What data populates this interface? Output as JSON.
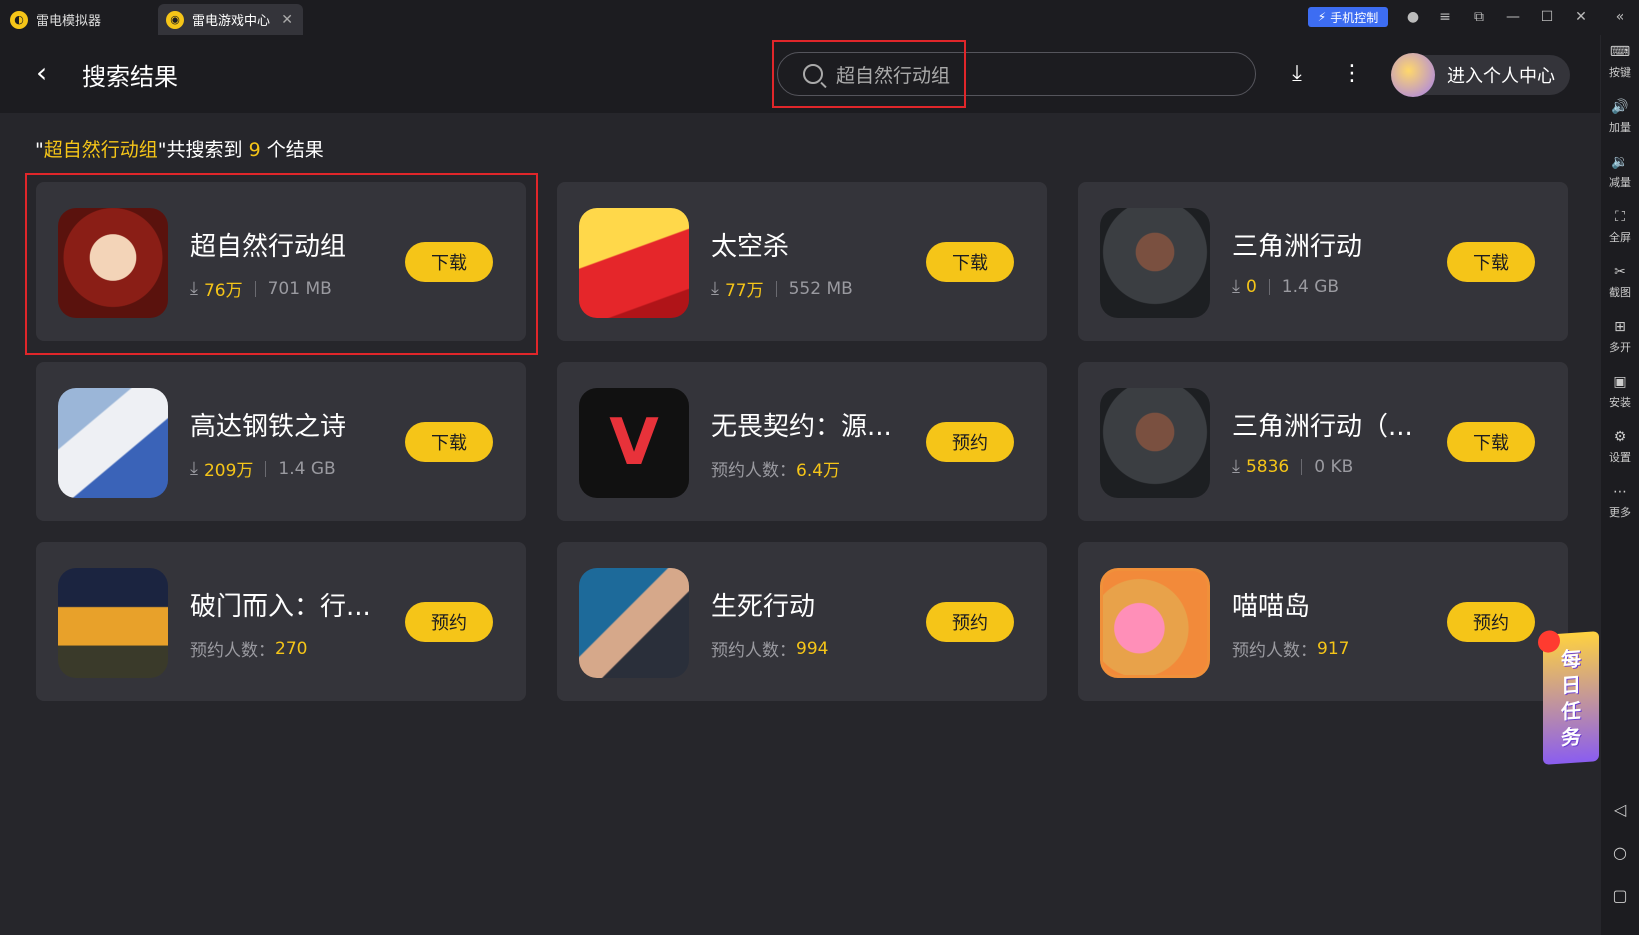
{
  "titlebar": {
    "tabs": [
      {
        "label": "雷电模拟器"
      },
      {
        "label": "雷电游戏中心"
      }
    ],
    "phone_control": "手机控制"
  },
  "header": {
    "title": "搜索结果",
    "search_value": "超自然行动组",
    "user_label": "进入个人中心"
  },
  "summary": {
    "query": "超自然行动组",
    "text_mid": "共搜索到",
    "count": "9",
    "text_end": "个结果"
  },
  "results": [
    {
      "name": "超自然行动组",
      "stat": "76万",
      "size": "701 MB",
      "action": "下载",
      "type": "download"
    },
    {
      "name": "太空杀",
      "stat": "77万",
      "size": "552 MB",
      "action": "下载",
      "type": "download"
    },
    {
      "name": "三角洲行动",
      "stat": "0",
      "size": "1.4 GB",
      "action": "下载",
      "type": "download"
    },
    {
      "name": "高达钢铁之诗",
      "stat": "209万",
      "size": "1.4 GB",
      "action": "下载",
      "type": "download"
    },
    {
      "name": "无畏契约：源...",
      "stat_label": "预约人数：",
      "stat": "6.4万",
      "action": "预约",
      "type": "reserve"
    },
    {
      "name": "三角洲行动（...",
      "stat": "5836",
      "size": "0 KB",
      "action": "下载",
      "type": "download"
    },
    {
      "name": "破门而入：行...",
      "stat_label": "预约人数：",
      "stat": "270",
      "action": "预约",
      "type": "reserve"
    },
    {
      "name": "生死行动",
      "stat_label": "预约人数：",
      "stat": "994",
      "action": "预约",
      "type": "reserve"
    },
    {
      "name": "喵喵岛",
      "stat_label": "预约人数：",
      "stat": "917",
      "action": "预约",
      "type": "reserve"
    }
  ],
  "sidebar": [
    {
      "label": "按键"
    },
    {
      "label": "加量"
    },
    {
      "label": "减量"
    },
    {
      "label": "全屏"
    },
    {
      "label": "截图"
    },
    {
      "label": "多开"
    },
    {
      "label": "安装"
    },
    {
      "label": "设置"
    },
    {
      "label": "更多"
    }
  ],
  "daily_task": "每日任务",
  "colors": {
    "accent": "#f5c518",
    "card": "#34343a",
    "background": "#26262b",
    "highlight_box": "#e0262a"
  }
}
